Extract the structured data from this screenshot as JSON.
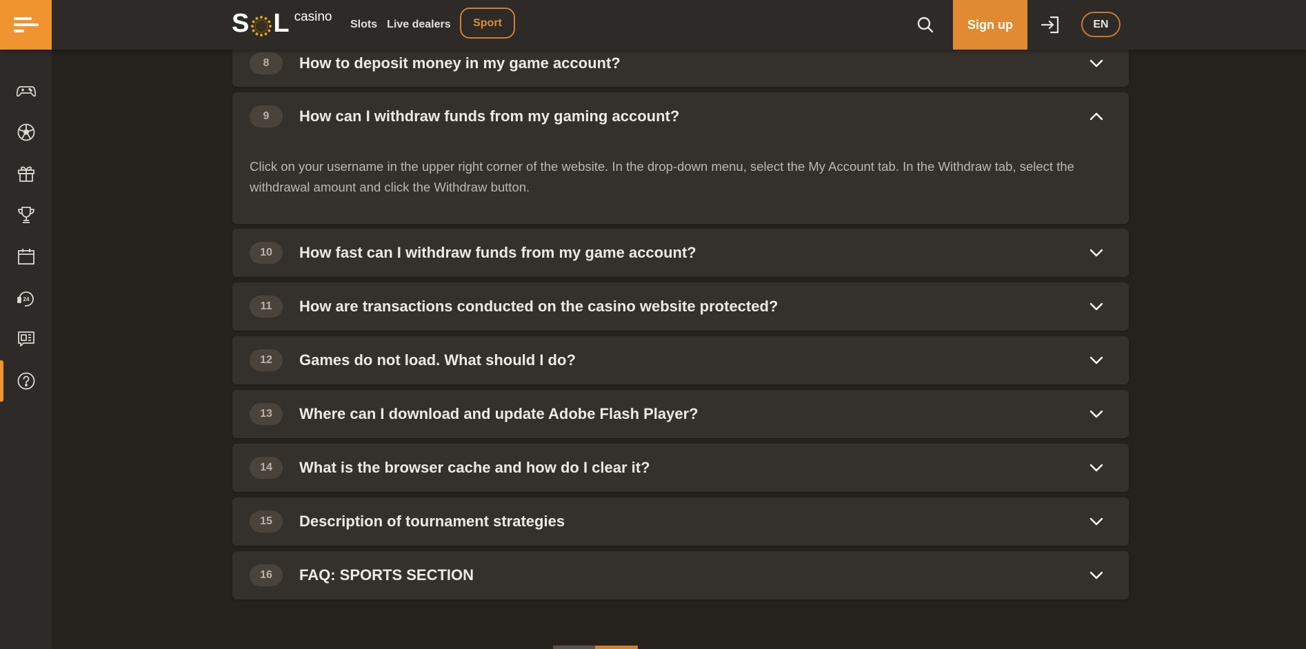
{
  "header": {
    "logo_main": "SOL",
    "logo_sub": "casino",
    "nav": [
      "Slots",
      "Live dealers"
    ],
    "sport_label": "Sport",
    "signup_label": "Sign up",
    "lang_label": "EN"
  },
  "colors": {
    "accent": "#f0942f",
    "page_bg": "#25221e",
    "card_bg": "#34302c",
    "header_bg": "#2d2a27"
  },
  "sidebar": {
    "items": [
      {
        "icon": "gamepad-icon",
        "label": "Games"
      },
      {
        "icon": "soccer-ball-icon",
        "label": "Sport"
      },
      {
        "icon": "gift-icon",
        "label": "Promotions"
      },
      {
        "icon": "trophy-icon",
        "label": "Tournaments"
      },
      {
        "icon": "calendar-icon",
        "label": "Calendar"
      },
      {
        "icon": "support-24-icon",
        "label": "Support"
      },
      {
        "icon": "news-chat-icon",
        "label": "News"
      },
      {
        "icon": "help-icon",
        "label": "FAQ",
        "active": true
      }
    ]
  },
  "faq": {
    "items": [
      {
        "number": "8",
        "question": "How to deposit money in my game account?",
        "expanded": false
      },
      {
        "number": "9",
        "question": "How can I withdraw funds from my gaming account?",
        "expanded": true,
        "answer": "Click on your username in the upper right corner of the website. In the drop-down menu, select the My Account tab. In the Withdraw tab, select the withdrawal amount and click the Withdraw button."
      },
      {
        "number": "10",
        "question": "How fast can I withdraw funds from my game account?",
        "expanded": false
      },
      {
        "number": "11",
        "question": "How are transactions conducted on the casino website protected?",
        "expanded": false
      },
      {
        "number": "12",
        "question": "Games do not load. What should I do?",
        "expanded": false
      },
      {
        "number": "13",
        "question": "Where can I download and update Adobe Flash Player?",
        "expanded": false
      },
      {
        "number": "14",
        "question": "What is the browser cache and how do I clear it?",
        "expanded": false
      },
      {
        "number": "15",
        "question": "Description of tournament strategies",
        "expanded": false
      },
      {
        "number": "16",
        "question": "FAQ: SPORTS SECTION",
        "expanded": false
      }
    ]
  }
}
